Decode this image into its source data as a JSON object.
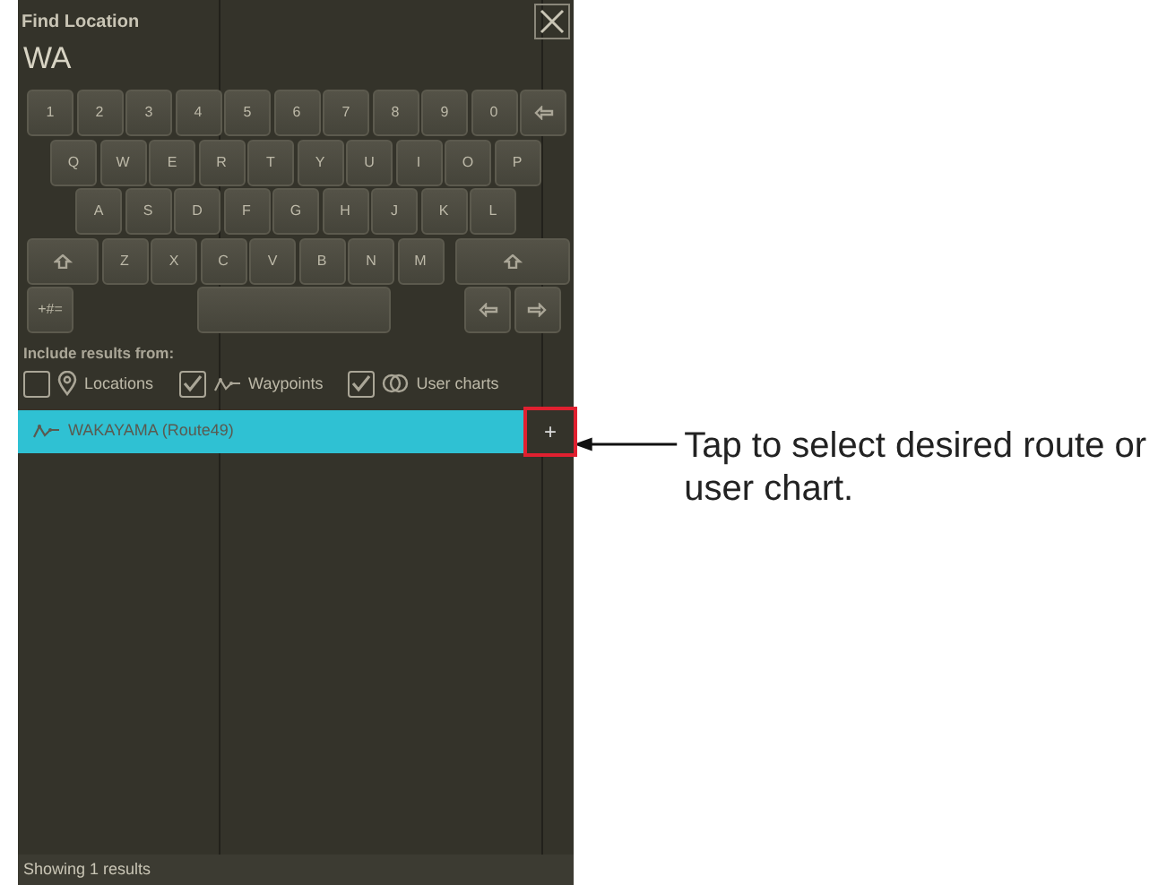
{
  "dialog": {
    "title": "Find Location",
    "query": "WA",
    "keyboard": [
      [
        {
          "kind": "char",
          "label": "1"
        },
        {
          "kind": "char",
          "label": "2"
        },
        {
          "kind": "char",
          "label": "3"
        },
        {
          "kind": "char",
          "label": "4"
        },
        {
          "kind": "char",
          "label": "5"
        },
        {
          "kind": "char",
          "label": "6"
        },
        {
          "kind": "char",
          "label": "7"
        },
        {
          "kind": "char",
          "label": "8"
        },
        {
          "kind": "char",
          "label": "9"
        },
        {
          "kind": "char",
          "label": "0"
        },
        {
          "kind": "backspace"
        }
      ],
      [
        {
          "kind": "char",
          "label": "Q"
        },
        {
          "kind": "char",
          "label": "W"
        },
        {
          "kind": "char",
          "label": "E"
        },
        {
          "kind": "char",
          "label": "R"
        },
        {
          "kind": "char",
          "label": "T"
        },
        {
          "kind": "char",
          "label": "Y"
        },
        {
          "kind": "char",
          "label": "U"
        },
        {
          "kind": "char",
          "label": "I"
        },
        {
          "kind": "char",
          "label": "O"
        },
        {
          "kind": "char",
          "label": "P"
        }
      ],
      [
        {
          "kind": "char",
          "label": "A"
        },
        {
          "kind": "char",
          "label": "S"
        },
        {
          "kind": "char",
          "label": "D"
        },
        {
          "kind": "char",
          "label": "F"
        },
        {
          "kind": "char",
          "label": "G"
        },
        {
          "kind": "char",
          "label": "H"
        },
        {
          "kind": "char",
          "label": "J"
        },
        {
          "kind": "char",
          "label": "K"
        },
        {
          "kind": "char",
          "label": "L"
        }
      ],
      [
        {
          "kind": "shift"
        },
        {
          "kind": "char",
          "label": "Z"
        },
        {
          "kind": "char",
          "label": "X"
        },
        {
          "kind": "char",
          "label": "C"
        },
        {
          "kind": "char",
          "label": "V"
        },
        {
          "kind": "char",
          "label": "B"
        },
        {
          "kind": "char",
          "label": "N"
        },
        {
          "kind": "char",
          "label": "M"
        },
        {
          "kind": "shiftwide"
        }
      ],
      [
        {
          "kind": "char",
          "label": "+#="
        },
        {
          "kind": "space"
        },
        {
          "kind": "left"
        },
        {
          "kind": "right"
        }
      ]
    ],
    "include_label": "Include results from:",
    "filters": [
      {
        "kind": "location",
        "label": "Locations",
        "checked": false
      },
      {
        "kind": "route",
        "label": "Waypoints",
        "checked": true
      },
      {
        "kind": "chart",
        "label": "User charts",
        "checked": true
      }
    ],
    "results": [
      {
        "kind": "route",
        "label": "WAKAYAMA (Route49)",
        "selected": true,
        "action": "+"
      }
    ],
    "status": "Showing 1 results"
  },
  "callout": {
    "text": "Tap to select desired route or user chart."
  }
}
